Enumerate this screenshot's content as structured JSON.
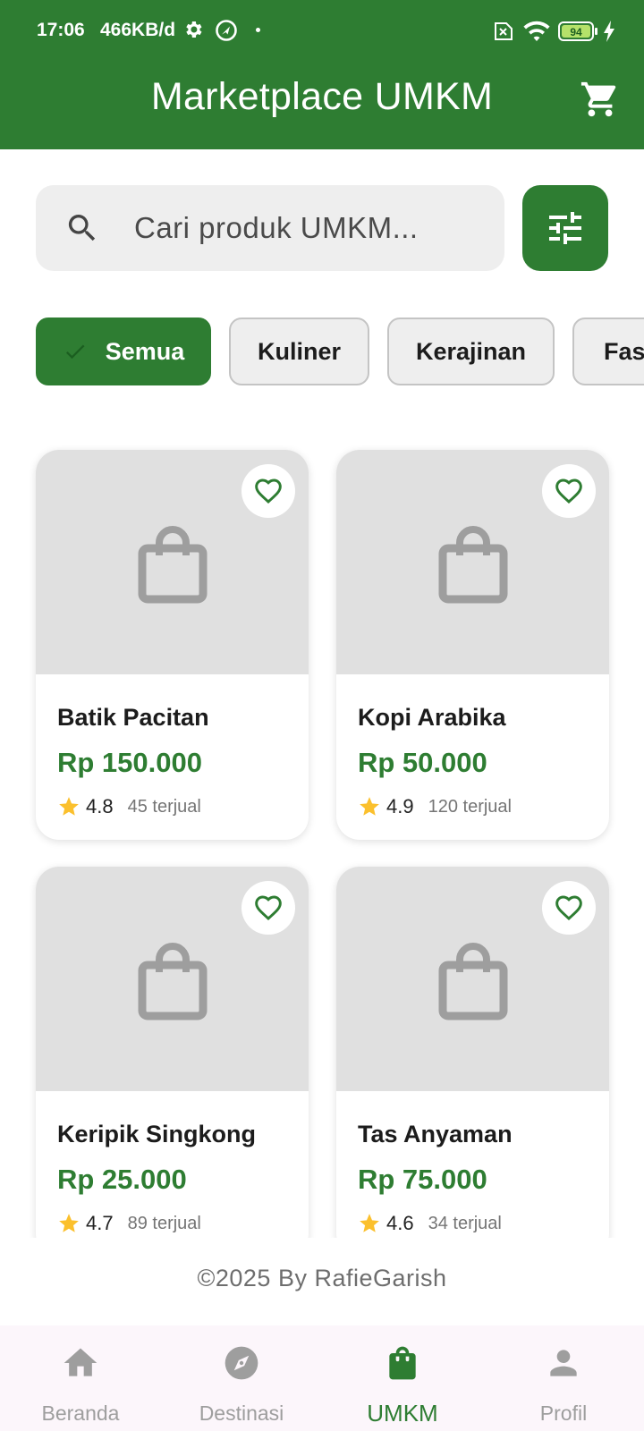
{
  "status_bar": {
    "time": "17:06",
    "speed": "466KB/d",
    "battery": "94",
    "icons": [
      "gear-icon",
      "navigation-icon",
      "no-sim-icon",
      "wifi-icon",
      "battery-icon",
      "charging-icon"
    ]
  },
  "header": {
    "title": "Marketplace UMKM",
    "cart_icon": "shopping-cart-icon",
    "background": "#2e7d32"
  },
  "search": {
    "placeholder": "Cari produk UMKM...",
    "value": "",
    "icon": "search-icon",
    "filter_icon": "tune-icon"
  },
  "categories": [
    {
      "label": "Semua",
      "selected": true
    },
    {
      "label": "Kuliner",
      "selected": false
    },
    {
      "label": "Kerajinan",
      "selected": false
    },
    {
      "label": "Fashion",
      "selected": false
    }
  ],
  "products": [
    {
      "name": "Batik Pacitan",
      "price": "Rp 150.000",
      "rating": "4.8",
      "sold": "45 terjual"
    },
    {
      "name": "Kopi Arabika",
      "price": "Rp 50.000",
      "rating": "4.9",
      "sold": "120 terjual"
    },
    {
      "name": "Keripik Singkong",
      "price": "Rp 25.000",
      "rating": "4.7",
      "sold": "89 terjual"
    },
    {
      "name": "Tas Anyaman",
      "price": "Rp 75.000",
      "rating": "4.6",
      "sold": "34 terjual"
    }
  ],
  "footer": {
    "copyright": "©2025 By RafieGarish"
  },
  "bottom_nav": [
    {
      "label": "Beranda",
      "icon": "home-icon",
      "active": false
    },
    {
      "label": "Destinasi",
      "icon": "compass-icon",
      "active": false
    },
    {
      "label": "UMKM",
      "icon": "shopping-bag-icon",
      "active": true
    },
    {
      "label": "Profil",
      "icon": "person-icon",
      "active": false
    }
  ],
  "colors": {
    "primary": "#2e7d32",
    "star": "#fbc02d",
    "muted": "#9e9e9e"
  }
}
